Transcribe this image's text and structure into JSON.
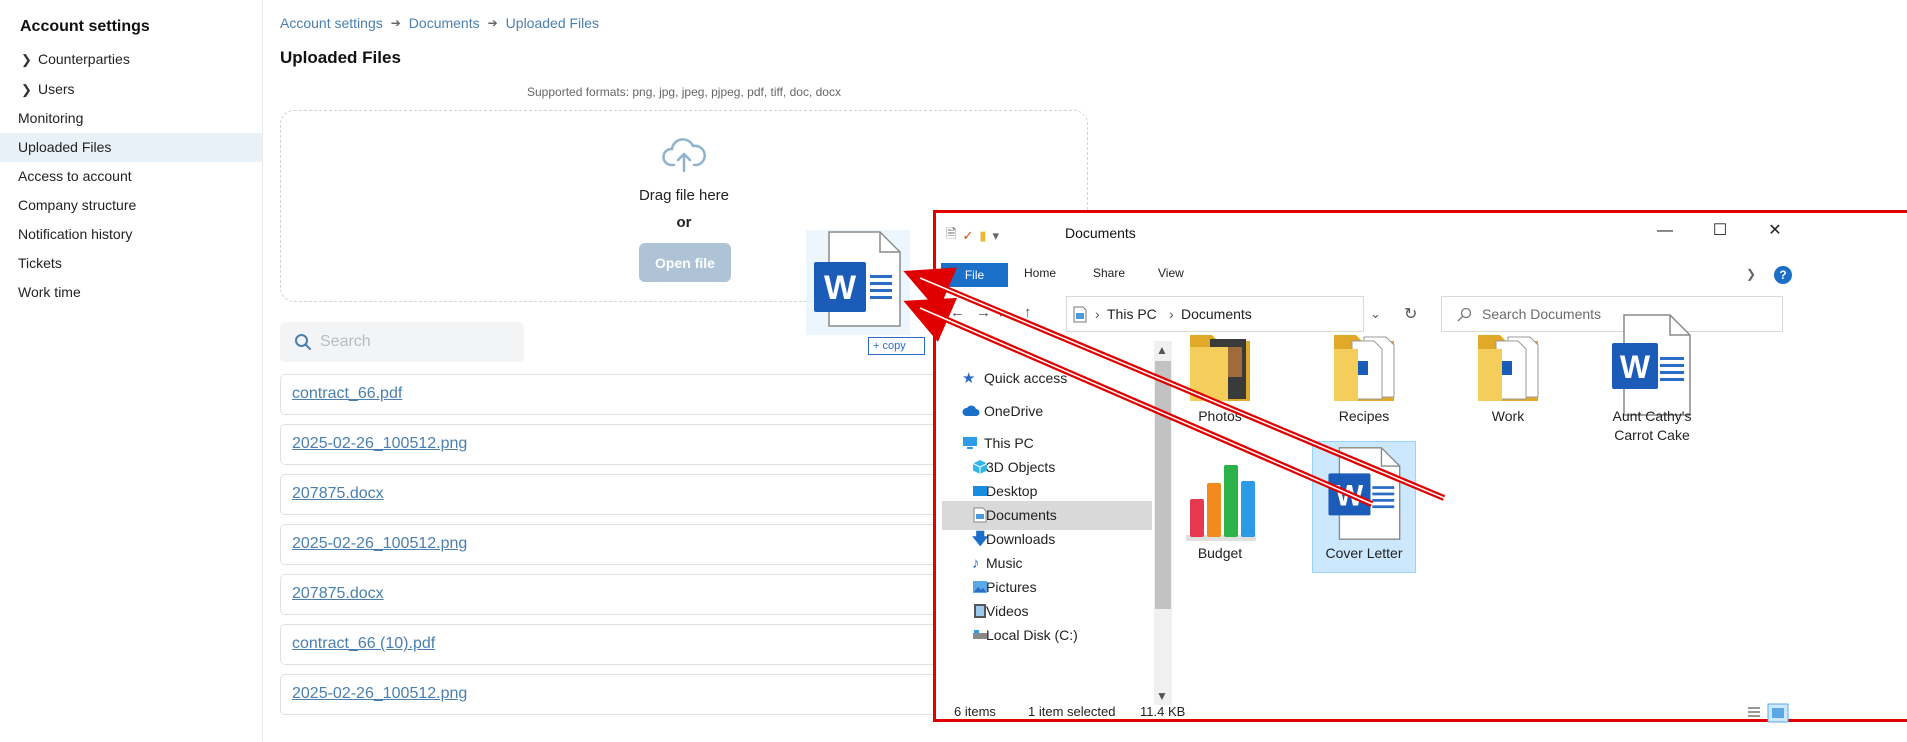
{
  "sidebar": {
    "title": "Account settings",
    "items": [
      {
        "label": "Counterparties",
        "expandable": true
      },
      {
        "label": "Users",
        "expandable": true
      },
      {
        "label": "Monitoring"
      },
      {
        "label": "Uploaded Files",
        "active": true
      },
      {
        "label": "Access to account"
      },
      {
        "label": "Company structure"
      },
      {
        "label": "Notification history"
      },
      {
        "label": "Tickets"
      },
      {
        "label": "Work time"
      }
    ]
  },
  "breadcrumb": [
    "Account settings",
    "Documents",
    "Uploaded Files"
  ],
  "page": {
    "title": "Uploaded Files",
    "supported_formats": "Supported formats: png, jpg, jpeg, pjpeg, pdf, tiff, doc, docx",
    "dropzone": {
      "drag_text": "Drag file here",
      "or_text": "or",
      "button_label": "Open file"
    },
    "search_placeholder": "Search",
    "files": [
      "contract_66.pdf",
      "2025-02-26_100512.png",
      "207875.docx",
      "2025-02-26_100512.png",
      "207875.docx",
      "contract_66 (10).pdf",
      "2025-02-26_100512.png"
    ]
  },
  "drag": {
    "copy_label": "+ copy"
  },
  "explorer": {
    "title": "Documents",
    "window_buttons": {
      "minimize": "—",
      "maximize": "☐",
      "close": "✕"
    },
    "ribbon_tabs": [
      "File",
      "Home",
      "Share",
      "View"
    ],
    "help": "?",
    "address": [
      "This PC",
      "Documents"
    ],
    "search_placeholder": "Search Documents",
    "nav": [
      {
        "label": "Quick access",
        "icon": "star-icon",
        "level": 0
      },
      {
        "label": "OneDrive",
        "icon": "cloud-icon",
        "level": 0
      },
      {
        "label": "This PC",
        "icon": "computer-icon",
        "level": 0
      },
      {
        "label": "3D Objects",
        "icon": "cube-icon",
        "level": 1
      },
      {
        "label": "Desktop",
        "icon": "desktop-icon",
        "level": 1
      },
      {
        "label": "Documents",
        "icon": "document-icon",
        "level": 1,
        "selected": true
      },
      {
        "label": "Downloads",
        "icon": "download-icon",
        "level": 1
      },
      {
        "label": "Music",
        "icon": "music-icon",
        "level": 1
      },
      {
        "label": "Pictures",
        "icon": "picture-icon",
        "level": 1
      },
      {
        "label": "Videos",
        "icon": "video-icon",
        "level": 1
      },
      {
        "label": "Local Disk (C:)",
        "icon": "drive-icon",
        "level": 1
      }
    ],
    "items": [
      {
        "label": "Photos",
        "kind": "folder-photo"
      },
      {
        "label": "Recipes",
        "kind": "folder-docs"
      },
      {
        "label": "Work",
        "kind": "folder-docs"
      },
      {
        "label": "Aunt Cathy's Carrot Cake",
        "kind": "word"
      },
      {
        "label": "Budget",
        "kind": "chart"
      },
      {
        "label": "Cover Letter",
        "kind": "word",
        "selected": true
      }
    ],
    "status": {
      "count": "6 items",
      "selected": "1 item selected",
      "size": "11.4 KB"
    }
  }
}
